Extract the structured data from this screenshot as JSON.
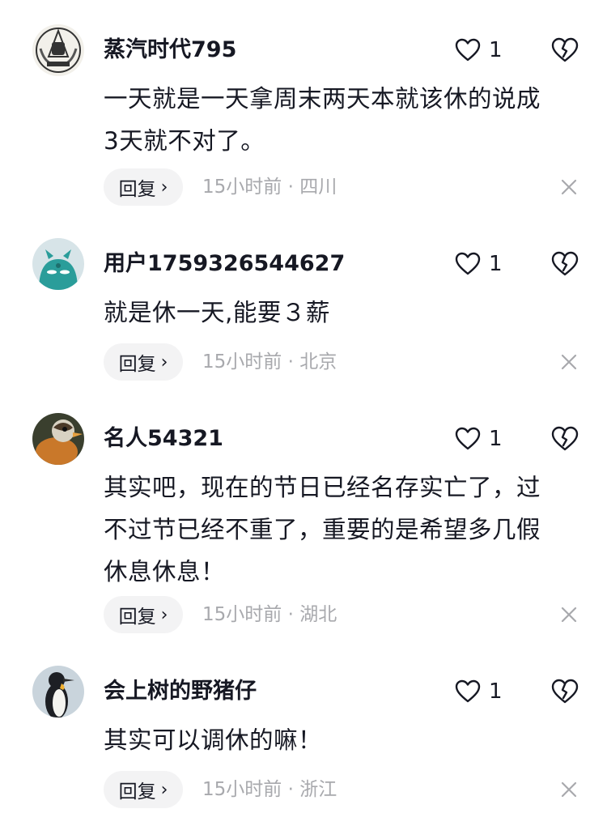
{
  "reply_label": "回复",
  "comments": [
    {
      "username": "蒸汽时代795",
      "likes": "1",
      "lines": [
        "一天就是一天拿周末两天本就该休的说成",
        "3天就不对了。"
      ],
      "time": "15小时前",
      "location": "四川",
      "avatar_icon": "fist-emblem-icon"
    },
    {
      "username": "用户1759326544627",
      "likes": "1",
      "lines": [
        "就是休一天,能要３薪"
      ],
      "time": "15小时前",
      "location": "北京",
      "avatar_icon": "teal-blob-icon"
    },
    {
      "username": "名人54321",
      "likes": "1",
      "lines": [
        "其实吧，现在的节日已经名存实亡了，过",
        "不过节已经不重了，重要的是希望多几假",
        "休息休息！"
      ],
      "time": "15小时前",
      "location": "湖北",
      "avatar_icon": "duck-icon"
    },
    {
      "username": "会上树的野猪仔",
      "likes": "1",
      "lines": [
        "其实可以调休的嘛！"
      ],
      "time": "15小时前",
      "location": "浙江",
      "avatar_icon": "penguin-icon"
    }
  ]
}
